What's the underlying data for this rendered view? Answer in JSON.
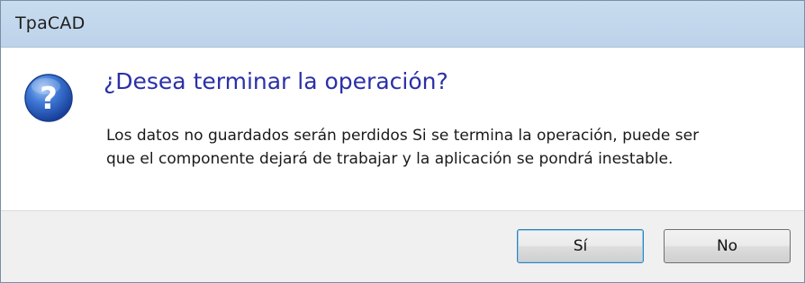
{
  "window": {
    "title": "TpaCAD"
  },
  "dialog": {
    "icon": "question-icon",
    "main_instruction": "¿Desea terminar la operación?",
    "content_lines": [
      "Los datos no guardados serán perdidos Si se termina la operación, puede ser",
      "que el componente dejará de trabajar y la aplicación se pondrá inestable."
    ]
  },
  "buttons": {
    "yes_label": "Sí",
    "no_label": "No"
  },
  "colors": {
    "main_instruction": "#2b30a8",
    "titlebar": "#c2d7ec",
    "footer": "#f0f0f0",
    "default_button_border": "#3c7fb1"
  }
}
